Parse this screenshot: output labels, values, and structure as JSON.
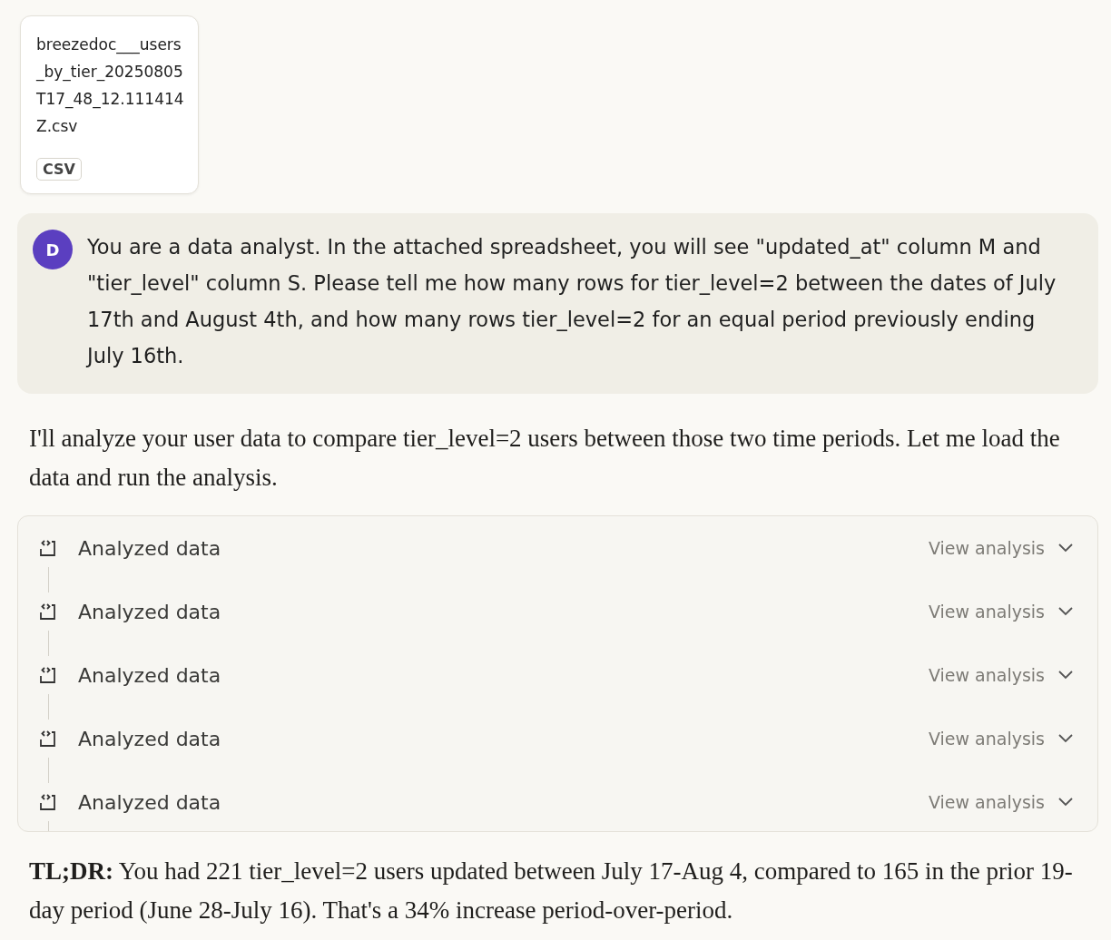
{
  "attachment": {
    "filename": "breezedoc___users_by_tier_20250805T17_48_12.111414Z.csv",
    "type_badge": "CSV"
  },
  "user_message": {
    "avatar_initial": "D",
    "text": "You are a data analyst. In the attached spreadsheet, you will see \"updated_at\" column M and \"tier_level\" column S. Please tell me how many rows for tier_level=2 between the dates of July 17th and August 4th, and how many rows tier_level=2 for an equal period previously ending July 16th."
  },
  "response_intro": "I'll analyze your user data to compare tier_level=2 users between those two time periods. Let me load the data and run the analysis.",
  "tool_steps": [
    {
      "label": "Analyzed data",
      "action": "View analysis"
    },
    {
      "label": "Analyzed data",
      "action": "View analysis"
    },
    {
      "label": "Analyzed data",
      "action": "View analysis"
    },
    {
      "label": "Analyzed data",
      "action": "View analysis"
    },
    {
      "label": "Analyzed data",
      "action": "View analysis"
    }
  ],
  "summary": "**TL;DR:** You had 221 tier_level=2 users updated between July 17-Aug 4, compared to 165 in the prior 19-day period (June 28-July 16). That's a 34% increase period-over-period."
}
